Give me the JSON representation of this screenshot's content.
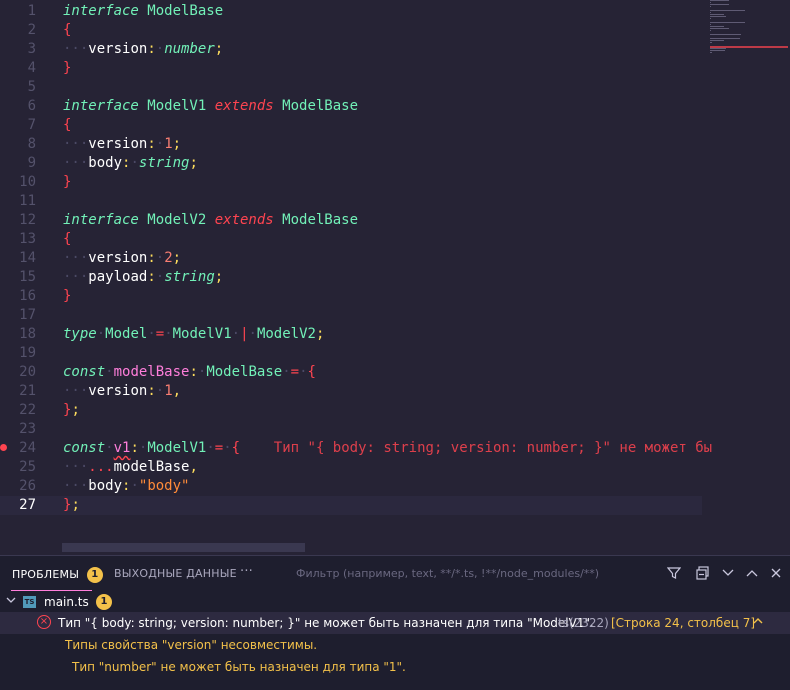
{
  "editor": {
    "lines": [
      {
        "n": "1",
        "tokens": [
          [
            "kw-ital",
            "interface"
          ],
          [
            "",
            ""
          ],
          [
            "tcls",
            " ModelBase"
          ]
        ]
      },
      {
        "n": "2",
        "tokens": [
          [
            "brace",
            "{"
          ]
        ]
      },
      {
        "n": "3",
        "tokens": [
          [
            "ws",
            "···"
          ],
          [
            "prop",
            "version"
          ],
          [
            "punc",
            ":"
          ],
          [
            "ws",
            "·"
          ],
          [
            "prim",
            "number"
          ],
          [
            "punc",
            ";"
          ]
        ]
      },
      {
        "n": "4",
        "tokens": [
          [
            "brace",
            "}"
          ]
        ]
      },
      {
        "n": "5",
        "tokens": []
      },
      {
        "n": "6",
        "tokens": [
          [
            "kw-ital",
            "interface"
          ],
          [
            "tcls",
            " ModelV1 "
          ],
          [
            "kw-pink",
            "extends"
          ],
          [
            "tcls",
            " ModelBase"
          ]
        ]
      },
      {
        "n": "7",
        "tokens": [
          [
            "brace",
            "{"
          ]
        ]
      },
      {
        "n": "8",
        "tokens": [
          [
            "ws",
            "···"
          ],
          [
            "prop",
            "version"
          ],
          [
            "punc",
            ":"
          ],
          [
            "ws",
            "·"
          ],
          [
            "num",
            "1"
          ],
          [
            "punc",
            ";"
          ]
        ]
      },
      {
        "n": "9",
        "tokens": [
          [
            "ws",
            "···"
          ],
          [
            "prop",
            "body"
          ],
          [
            "punc",
            ":"
          ],
          [
            "ws",
            "·"
          ],
          [
            "prim",
            "string"
          ],
          [
            "punc",
            ";"
          ]
        ]
      },
      {
        "n": "10",
        "tokens": [
          [
            "brace",
            "}"
          ]
        ]
      },
      {
        "n": "11",
        "tokens": []
      },
      {
        "n": "12",
        "tokens": [
          [
            "kw-ital",
            "interface"
          ],
          [
            "tcls",
            " ModelV2 "
          ],
          [
            "kw-pink",
            "extends"
          ],
          [
            "tcls",
            " ModelBase"
          ]
        ]
      },
      {
        "n": "13",
        "tokens": [
          [
            "brace",
            "{"
          ]
        ]
      },
      {
        "n": "14",
        "tokens": [
          [
            "ws",
            "···"
          ],
          [
            "prop",
            "version"
          ],
          [
            "punc",
            ":"
          ],
          [
            "ws",
            "·"
          ],
          [
            "num",
            "2"
          ],
          [
            "punc",
            ";"
          ]
        ]
      },
      {
        "n": "15",
        "tokens": [
          [
            "ws",
            "···"
          ],
          [
            "prop",
            "payload"
          ],
          [
            "punc",
            ":"
          ],
          [
            "ws",
            "·"
          ],
          [
            "prim",
            "string"
          ],
          [
            "punc",
            ";"
          ]
        ]
      },
      {
        "n": "16",
        "tokens": [
          [
            "brace",
            "}"
          ]
        ]
      },
      {
        "n": "17",
        "tokens": []
      },
      {
        "n": "18",
        "tokens": [
          [
            "kw-ital",
            "type"
          ],
          [
            "ws",
            "·"
          ],
          [
            "tcls",
            "Model"
          ],
          [
            "ws",
            "·"
          ],
          [
            "tp",
            "="
          ],
          [
            "ws",
            "·"
          ],
          [
            "tcls",
            "ModelV1"
          ],
          [
            "ws",
            "·"
          ],
          [
            "tp",
            "|"
          ],
          [
            "ws",
            "·"
          ],
          [
            "tcls",
            "ModelV2"
          ],
          [
            "punc",
            ";"
          ]
        ]
      },
      {
        "n": "19",
        "tokens": []
      },
      {
        "n": "20",
        "tokens": [
          [
            "kw-ital",
            "const"
          ],
          [
            "ws",
            "·"
          ],
          [
            "var",
            "modelBase"
          ],
          [
            "punc",
            ":"
          ],
          [
            "ws",
            "·"
          ],
          [
            "tcls",
            "ModelBase"
          ],
          [
            "ws",
            "·"
          ],
          [
            "tp",
            "="
          ],
          [
            "ws",
            "·"
          ],
          [
            "brace",
            "{"
          ]
        ]
      },
      {
        "n": "21",
        "tokens": [
          [
            "ws",
            "···"
          ],
          [
            "prop",
            "version"
          ],
          [
            "punc",
            ":"
          ],
          [
            "ws",
            "·"
          ],
          [
            "num",
            "1"
          ],
          [
            "punc",
            ","
          ]
        ]
      },
      {
        "n": "22",
        "tokens": [
          [
            "brace",
            "}"
          ],
          [
            "punc",
            ";"
          ]
        ]
      },
      {
        "n": "23",
        "tokens": []
      },
      {
        "n": "24",
        "tokens": [
          [
            "kw-ital",
            "const"
          ],
          [
            "ws",
            "·"
          ],
          [
            "var squiggle",
            "v1"
          ],
          [
            "punc",
            ":"
          ],
          [
            "ws",
            "·"
          ],
          [
            "tcls",
            "ModelV1"
          ],
          [
            "ws",
            "·"
          ],
          [
            "tp",
            "="
          ],
          [
            "ws",
            "·"
          ],
          [
            "brace",
            "{"
          ],
          [
            "ghost",
            "    Тип \"{ body: string; version: number; }\" не может бы"
          ]
        ],
        "error": true
      },
      {
        "n": "25",
        "tokens": [
          [
            "ws",
            "···"
          ],
          [
            "tp",
            "..."
          ],
          [
            "prop",
            "modelBase"
          ],
          [
            "punc",
            ","
          ]
        ]
      },
      {
        "n": "26",
        "tokens": [
          [
            "ws",
            "···"
          ],
          [
            "prop",
            "body"
          ],
          [
            "punc",
            ":"
          ],
          [
            "ws",
            "·"
          ],
          [
            "str",
            "\"body\""
          ]
        ]
      },
      {
        "n": "27",
        "tokens": [
          [
            "brace",
            "}"
          ],
          [
            "punc",
            ";"
          ]
        ],
        "current": true
      }
    ]
  },
  "panel": {
    "tab_problems": "ПРОБЛЕМЫ",
    "problems_count": "1",
    "tab_output": "ВЫХОДНЫЕ ДАННЫЕ",
    "more": "···",
    "filter_placeholder": "Фильтр (например, text, **/*.ts, !**/node_modules/**)",
    "file": {
      "name": "main.ts",
      "count": "1",
      "icon_label": "TS"
    },
    "error": {
      "message": "Тип \"{ body: string; version: number; }\" не может быть назначен для типа \"ModelV1\".",
      "code": "ts(2322)",
      "location": "[Строка 24, столбец 7]",
      "detail1": "Типы свойства \"version\" несовместимы.",
      "detail2": "Тип \"number\" не может быть назначен для типа \"1\"."
    }
  },
  "colors": {
    "background": "#262335",
    "panel": "#1e1e2e",
    "error": "#fe4450",
    "badge": "#f3c14a"
  }
}
